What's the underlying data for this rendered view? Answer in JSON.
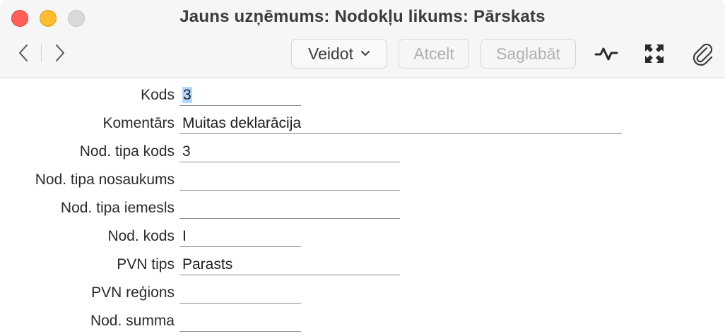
{
  "window": {
    "title": "Jauns uzņēmums: Nodokļu likums: Pārskats"
  },
  "toolbar": {
    "create_label": "Veidot",
    "cancel_label": "Atcelt",
    "save_label": "Saglabāt",
    "icons": {
      "back": "chevron-left-icon",
      "forward": "chevron-right-icon",
      "dropdown": "chevron-down-icon",
      "activity": "pulse-icon",
      "expand": "expand-arrows-icon",
      "attach": "paperclip-icon"
    }
  },
  "colors": {
    "close": "#ff5f57",
    "minimize": "#febc2e",
    "zoom": "#d9d9d9",
    "selection": "#b3d7ff",
    "disabled_text": "#b0b0b0"
  },
  "form": {
    "fields": [
      {
        "label": "Kods",
        "value": "3"
      },
      {
        "label": "Komentārs",
        "value": "Muitas deklarācija"
      },
      {
        "label": "Nod. tipa kods",
        "value": "3"
      },
      {
        "label": "Nod. tipa nosaukums",
        "value": ""
      },
      {
        "label": "Nod. tipa iemesls",
        "value": ""
      },
      {
        "label": "Nod. kods",
        "value": "I"
      },
      {
        "label": "PVN tips",
        "value": "Parasts"
      },
      {
        "label": "PVN reģions",
        "value": ""
      },
      {
        "label": "Nod. summa",
        "value": ""
      }
    ]
  }
}
